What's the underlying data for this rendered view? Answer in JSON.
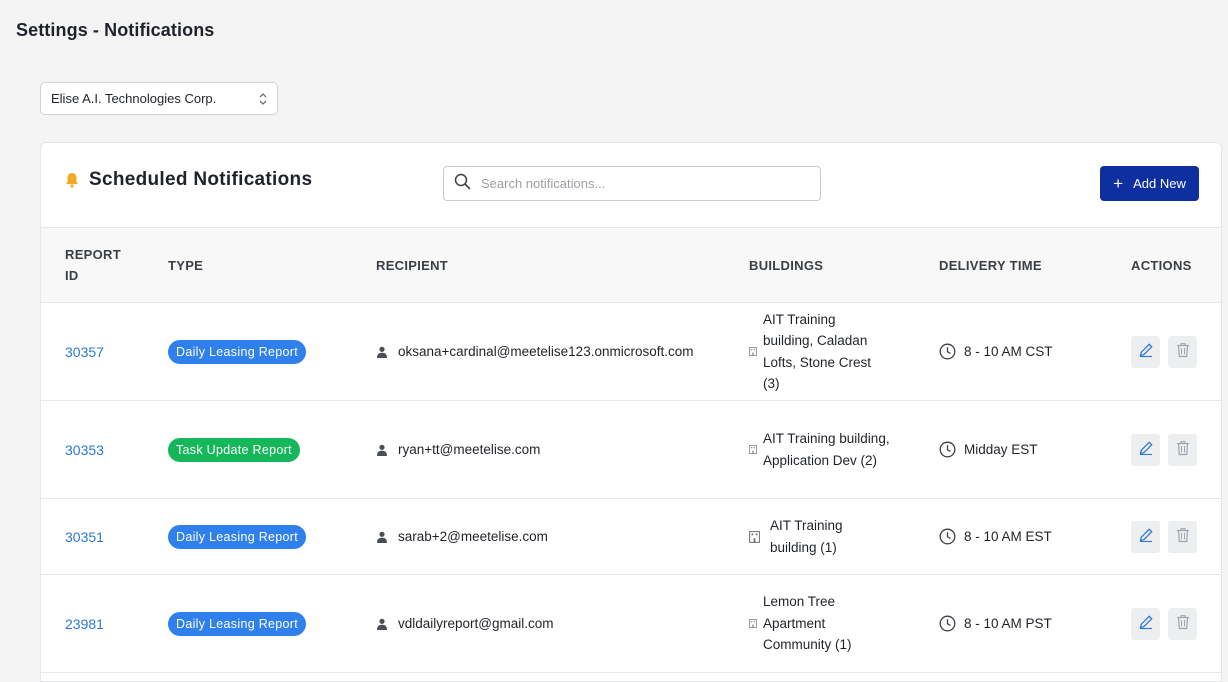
{
  "page": {
    "title": "Settings - Notifications"
  },
  "company_select": {
    "value": "Elise A.I. Technologies Corp."
  },
  "panel": {
    "title": "Scheduled Notifications",
    "search_placeholder": "Search notifications...",
    "add_button_label": "Add New"
  },
  "table": {
    "headers": {
      "report_id_line1": "REPORT",
      "report_id_line2": "ID",
      "type": "TYPE",
      "recipient": "RECIPIENT",
      "buildings": "BUILDINGS",
      "delivery_time": "DELIVERY TIME",
      "actions": "ACTIONS"
    },
    "rows": [
      {
        "report_id": "30357",
        "type": "Daily Leasing Report",
        "type_color": "#2f80ed",
        "recipient": "oksana+cardinal@meetelise123.onmicrosoft.com",
        "buildings": "AIT Training building, Caladan Lofts, Stone Crest (3)",
        "delivery_time": "8 - 10 AM CST"
      },
      {
        "report_id": "30353",
        "type": "Task Update Report",
        "type_color": "#16b65a",
        "recipient": "ryan+tt@meetelise.com",
        "buildings": "AIT Training building, Application Dev (2)",
        "delivery_time": "Midday EST"
      },
      {
        "report_id": "30351",
        "type": "Daily Leasing Report",
        "type_color": "#2f80ed",
        "recipient": "sarab+2@meetelise.com",
        "buildings": "AIT Training building (1)",
        "delivery_time": "8 - 10 AM EST"
      },
      {
        "report_id": "23981",
        "type": "Daily Leasing Report",
        "type_color": "#2f80ed",
        "recipient": "vdldailyreport@gmail.com",
        "buildings": "Lemon Tree Apartment Community (1)",
        "delivery_time": "8 - 10 AM PST"
      }
    ]
  },
  "colors": {
    "primary_button": "#0d2fa0",
    "link": "#2d7ad6",
    "bell": "#f5a623",
    "edit_icon": "#2d7ad6",
    "delete_icon": "#a0a5ab"
  },
  "icons": {
    "bell": "bell-icon",
    "search": "search-icon",
    "plus": "plus-icon",
    "select": "chevron-up-down-icon",
    "person": "person-icon",
    "building": "building-icon",
    "clock": "clock-icon",
    "edit": "pencil-icon",
    "delete": "trash-icon"
  }
}
